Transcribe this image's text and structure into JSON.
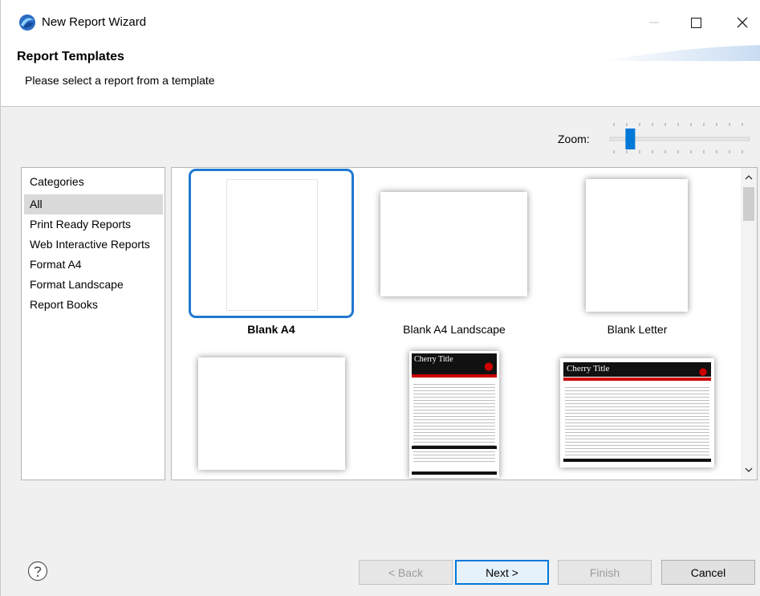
{
  "window": {
    "title": "New Report Wizard",
    "minimize_icon": "minimize-icon",
    "maximize_icon": "maximize-icon",
    "close_icon": "close-icon"
  },
  "header": {
    "title": "Report Templates",
    "description": "Please select a report from a template"
  },
  "zoom": {
    "label": "Zoom:",
    "level": 0.12
  },
  "categories": {
    "heading": "Categories",
    "items": [
      "All",
      "Print Ready Reports",
      "Web Interactive Reports",
      "Format A4",
      "Format Landscape",
      "Report Books"
    ],
    "selected": "All"
  },
  "templates": [
    {
      "label": "Blank A4",
      "selected": true
    },
    {
      "label": "Blank A4 Landscape",
      "selected": false
    },
    {
      "label": "Blank Letter",
      "selected": false
    },
    {
      "label": "",
      "selected": false
    },
    {
      "label": "",
      "preview_title": "Cherry Title",
      "selected": false
    },
    {
      "label": "",
      "preview_title": "Cherry Title",
      "selected": false
    }
  ],
  "buttons": {
    "back": "< Back",
    "next": "Next >",
    "finish": "Finish",
    "cancel": "Cancel"
  },
  "colors": {
    "selection_border": "#1f79d1",
    "slider_thumb": "#0078d7",
    "cherry_red": "#cc0000"
  }
}
